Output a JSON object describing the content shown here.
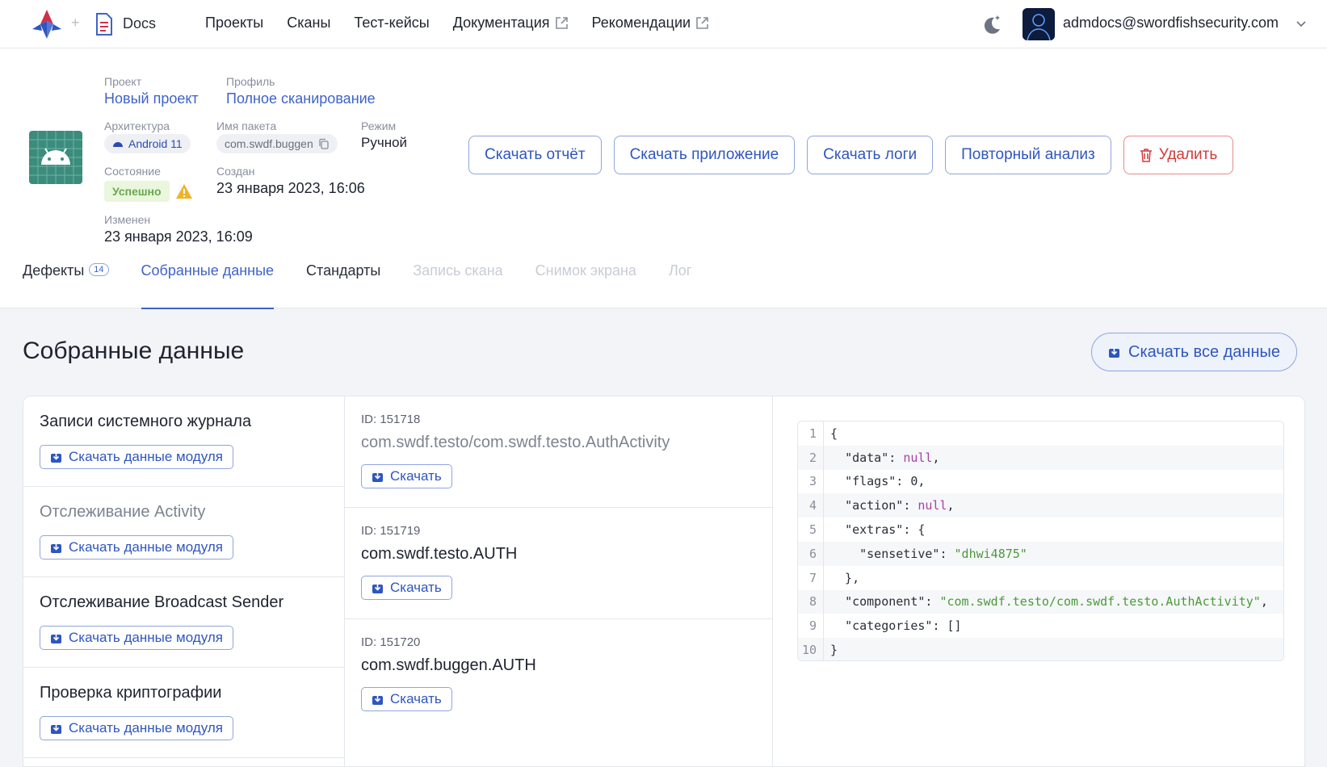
{
  "nav": {
    "docs_label": "Docs",
    "items": [
      "Проекты",
      "Сканы",
      "Тест-кейсы",
      "Документация",
      "Рекомендации"
    ],
    "user_email": "admdocs@swordfishsecurity.com"
  },
  "header": {
    "project_label": "Проект",
    "project_value": "Новый проект",
    "profile_label": "Профиль",
    "profile_value": "Полное сканирование",
    "arch_label": "Архитектура",
    "arch_value": "Android 11",
    "package_label": "Имя пакета",
    "package_value": "com.swdf.buggen",
    "mode_label": "Режим",
    "mode_value": "Ручной",
    "state_label": "Состояние",
    "state_value": "Успешно",
    "created_label": "Создан",
    "created_value": "23 января 2023, 16:06",
    "modified_label": "Изменен",
    "modified_value": "23 января 2023, 16:09"
  },
  "actions": {
    "download_report": "Скачать отчёт",
    "download_app": "Скачать приложение",
    "download_logs": "Скачать логи",
    "reanalyze": "Повторный анализ",
    "delete": "Удалить"
  },
  "tabs": {
    "defects": "Дефекты",
    "defects_count": "14",
    "collected": "Собранные данные",
    "standards": "Стандарты",
    "scan_record": "Запись скана",
    "screenshot": "Снимок экрана",
    "log": "Лог"
  },
  "main": {
    "title": "Собранные данные",
    "download_all": "Скачать все данные",
    "module_button": "Скачать данные модуля",
    "modules": [
      "Записи системного журнала",
      "Отслеживание Activity",
      "Отслеживание Broadcast Sender",
      "Проверка криптографии"
    ],
    "record_button": "Скачать",
    "records": [
      {
        "id": "ID: 151718",
        "name": "com.swdf.testo/com.swdf.testo.AuthActivity"
      },
      {
        "id": "ID: 151719",
        "name": "com.swdf.testo.AUTH"
      },
      {
        "id": "ID: 151720",
        "name": "com.swdf.buggen.AUTH"
      }
    ]
  },
  "colors": {
    "accent": "#3f63c8",
    "danger": "#d33a3a",
    "success": "#6aa84f"
  }
}
